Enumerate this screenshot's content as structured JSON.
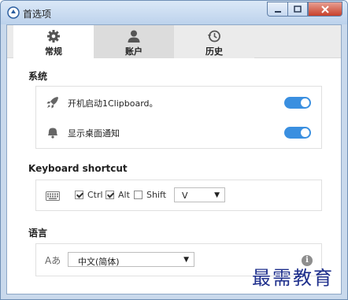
{
  "window": {
    "title": "首选项"
  },
  "tabs": [
    {
      "label": "常规",
      "icon": "gear-icon"
    },
    {
      "label": "账户",
      "icon": "user-icon"
    },
    {
      "label": "历史",
      "icon": "history-icon"
    }
  ],
  "system": {
    "title": "系统",
    "items": [
      {
        "label": "开机启动1Clipboard。",
        "icon": "rocket-icon",
        "enabled": true
      },
      {
        "label": "显示桌面通知",
        "icon": "notification-bell-icon",
        "enabled": true
      }
    ]
  },
  "shortcut": {
    "title": "Keyboard shortcut",
    "icon": "keyboard-icon",
    "ctrl": {
      "label": "Ctrl",
      "checked": true
    },
    "alt": {
      "label": "Alt",
      "checked": true
    },
    "shift": {
      "label": "Shift",
      "checked": false
    },
    "key": "V"
  },
  "language": {
    "title": "语言",
    "icon": "language-icon",
    "icon_text": "Aあ",
    "selected": "中文(简体)"
  },
  "watermark": "最需教育",
  "colors": {
    "accent": "#3a8fe0",
    "titlebar": "#bcd2ec",
    "close": "#c7402a"
  }
}
